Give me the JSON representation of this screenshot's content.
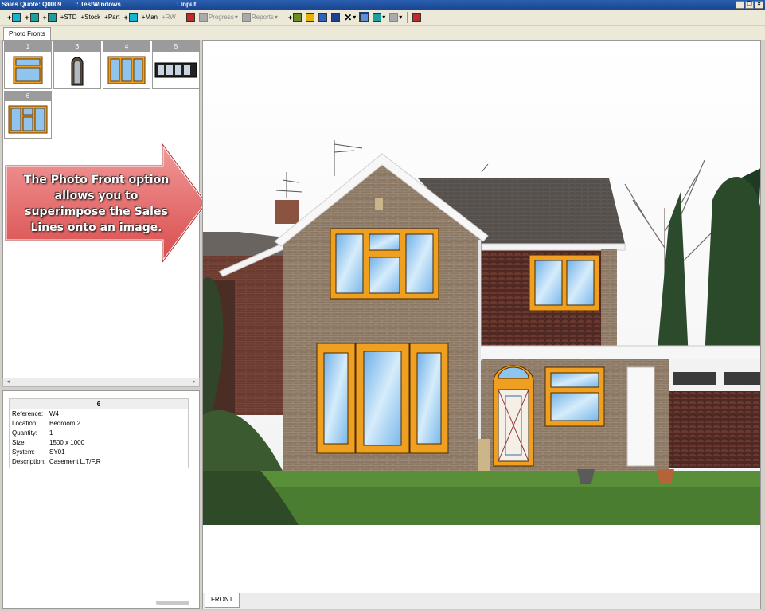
{
  "titlebar": {
    "quote": "Sales Quote: Q0009",
    "customer": ": TestWindows",
    "mode": ": Input"
  },
  "toolbar": {
    "std_label": "+STD",
    "stock_label": "+Stock",
    "part_label": "+Part",
    "man_label": "+Man",
    "rw_label": "+RW",
    "progress_label": "Progress",
    "reports_label": "Reports"
  },
  "tabs": {
    "photo_fronts": "Photo Fronts",
    "front": "FRONT"
  },
  "thumbnails": [
    {
      "number": "1"
    },
    {
      "number": "3"
    },
    {
      "number": "4"
    },
    {
      "number": "5"
    },
    {
      "number": "6"
    }
  ],
  "callout": {
    "text": "The Photo Front option allows you to superimpose the Sales Lines onto an image."
  },
  "details": {
    "header": "6",
    "rows": [
      {
        "key": "Reference:",
        "value": "W4"
      },
      {
        "key": "Location:",
        "value": "Bedroom 2"
      },
      {
        "key": "Quantity:",
        "value": "1"
      },
      {
        "key": "Size:",
        "value": "1500 x 1000"
      },
      {
        "key": "System:",
        "value": "SY01"
      },
      {
        "key": "Description:",
        "value": "Casement L.T/F.R"
      }
    ]
  },
  "colors": {
    "frame": "#f0a020",
    "glass": "#8fc4ee",
    "brick": "#8a7560",
    "roof": "#5a5450",
    "callout_fill": "#e56b6b"
  }
}
